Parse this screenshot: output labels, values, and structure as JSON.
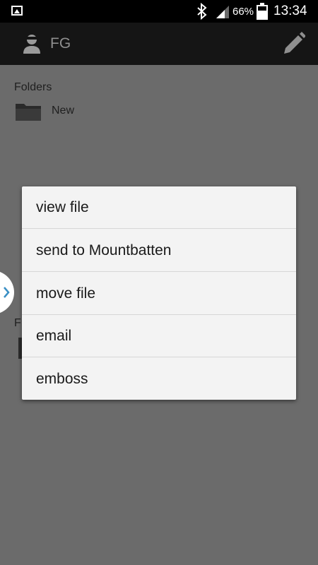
{
  "status_bar": {
    "battery_percent": "66%",
    "time": "13:34"
  },
  "action_bar": {
    "title": "FG"
  },
  "content": {
    "folders_label": "Folders",
    "folders": [
      {
        "name": "New"
      }
    ],
    "files_label_partial": "F"
  },
  "menu": {
    "items": [
      {
        "label": "view file"
      },
      {
        "label": "send to Mountbatten"
      },
      {
        "label": "move file"
      },
      {
        "label": "email"
      },
      {
        "label": "emboss"
      }
    ]
  },
  "colors": {
    "dim_background": "#6b6b6b",
    "menu_background": "#f3f3f3",
    "accent_chevron": "#3a8fc4"
  }
}
